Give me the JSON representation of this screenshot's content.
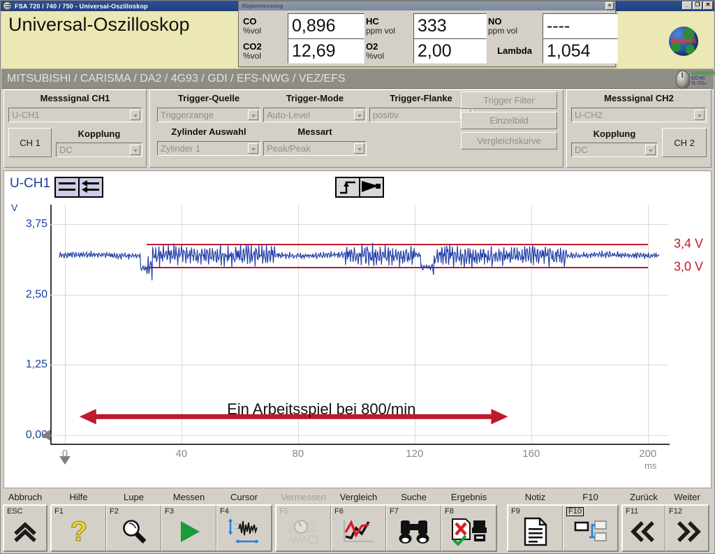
{
  "window": {
    "title": "FSA 720 / 740 / 750 - Universal-Oszilloskop",
    "icon": "oscilloscope-icon",
    "buttons": {
      "minimize": "_",
      "restore": "❐",
      "close": "✕"
    }
  },
  "header": {
    "title": "Universal-Oszilloskop",
    "logo_text": "BOSCH"
  },
  "abgas": {
    "title": "Abgasmessung",
    "close_label": "✕",
    "measurements": [
      {
        "name": "CO",
        "unit": "%vol",
        "value": "0,896"
      },
      {
        "name": "HC",
        "unit": "ppm vol",
        "value": "333"
      },
      {
        "name": "NO",
        "unit": "ppm vol",
        "value": "----"
      },
      {
        "name": "CO2",
        "unit": "%vol",
        "value": "12,69"
      },
      {
        "name": "O2",
        "unit": "%vol",
        "value": "2,00"
      },
      {
        "name": "Lambda",
        "unit": "",
        "value": "1,054"
      }
    ]
  },
  "breadcrumb": {
    "text": "MITSUBISHI / CARISMA / DA2 / 4G93 / GDI / EFS-NWG / VEZ/EFS"
  },
  "controls": {
    "ch1": {
      "group_title": "Messsignal CH1",
      "signal": "U-CH1",
      "channel_button": "CH 1",
      "coupling_title": "Kopplung",
      "coupling": "DC"
    },
    "trigger": {
      "source_title": "Trigger-Quelle",
      "source": "Triggerzange",
      "mode_title": "Trigger-Mode",
      "mode": "Auto-Level",
      "edge_title": "Trigger-Flanke",
      "edge": "positiv",
      "cylinder_title": "Zylinder Auswahl",
      "cylinder": "Zylinder 1",
      "measure_title": "Messart",
      "measure": "Peak/Peak",
      "filter_button": "Trigger Filter",
      "single_button": "Einzelbild",
      "compare_button": "Vergleichskurve"
    },
    "ch2": {
      "group_title": "Messsignal CH2",
      "signal": "U-CH2",
      "channel_button": "CH 2",
      "coupling_title": "Kopplung",
      "coupling": "DC"
    }
  },
  "chart_data": {
    "type": "line",
    "title": "U-CH1",
    "xlabel": "ms",
    "ylabel": "V",
    "xlim": [
      -5,
      207
    ],
    "ylim": [
      -0.15,
      4.1
    ],
    "xticks": [
      0,
      40,
      80,
      120,
      160,
      200
    ],
    "xticklabels": [
      "0",
      "40",
      "80",
      "120",
      "160",
      "200"
    ],
    "yticks": [
      0.0,
      1.25,
      2.5,
      3.75
    ],
    "yticklabels": [
      "0,00",
      "1,25",
      "2,50",
      "3,75"
    ],
    "grid": true,
    "series": [
      {
        "name": "U-CH1",
        "color": "#2340a8",
        "description": "Noisy injector/sensor voltage signal oscillating around 3,2 V with higher-amplitude bursts",
        "baseline": 3.2,
        "noise_amplitude": 0.06,
        "burst_amplitude": 0.2
      }
    ],
    "limit_lines": [
      {
        "label": "3,4 V",
        "value": 3.4,
        "color": "#c0182c",
        "x_start": 28,
        "x_end": 200
      },
      {
        "label": "3,0 V",
        "value": 3.0,
        "color": "#c0182c",
        "x_start": 28,
        "x_end": 200
      }
    ],
    "annotations": [
      {
        "text": "Ein Arbeitsspiel bei 800/min",
        "x_center": 88,
        "y_text": 0.62,
        "arrow_y": 0.33,
        "arrow_x_start": 5,
        "arrow_x_end": 152,
        "color": "#c0182c"
      }
    ],
    "cursors": [
      {
        "axis": "y",
        "value": 0.0,
        "icon": "left-triangle-cursor"
      },
      {
        "axis": "x",
        "value": 0.0,
        "icon": "down-triangle-cursor"
      }
    ],
    "toolbar_icons": [
      {
        "name": "channel-position-icon",
        "x": 6
      },
      {
        "name": "trigger-edge-icon",
        "x": 100
      }
    ]
  },
  "functionbar": {
    "groups": [
      {
        "keys": [
          {
            "caption": "Abbruch",
            "fkey": "ESC",
            "icon": "double-chevron-up-icon",
            "disabled": false,
            "boxed": false
          }
        ]
      },
      {
        "keys": [
          {
            "caption": "Hilfe",
            "fkey": "F1",
            "icon": "question-mark-icon",
            "disabled": false,
            "boxed": false
          },
          {
            "caption": "Lupe",
            "fkey": "F2",
            "icon": "magnifier-icon",
            "disabled": false,
            "boxed": false
          },
          {
            "caption": "Messen",
            "fkey": "F3",
            "icon": "play-triangle-icon",
            "disabled": false,
            "boxed": false
          },
          {
            "caption": "Cursor",
            "fkey": "F4",
            "icon": "cursor-waveform-icon",
            "disabled": false,
            "boxed": false
          }
        ]
      },
      {
        "keys": [
          {
            "caption": "Vermessen",
            "fkey": "F5",
            "icon": "gauge-waveform-icon",
            "disabled": true,
            "boxed": false
          },
          {
            "caption": "Vergleich",
            "fkey": "F6",
            "icon": "compare-curves-icon",
            "disabled": false,
            "boxed": false
          },
          {
            "caption": "Suche",
            "fkey": "F7",
            "icon": "binoculars-icon",
            "disabled": false,
            "boxed": false
          },
          {
            "caption": "Ergebnis",
            "fkey": "F8",
            "icon": "result-printer-icon",
            "disabled": false,
            "boxed": false
          }
        ]
      },
      {
        "keys": [
          {
            "caption": "Notiz",
            "fkey": "F9",
            "icon": "document-icon",
            "disabled": false,
            "boxed": false
          },
          {
            "caption": "F10",
            "fkey": "F10",
            "icon": "window-tile-icon",
            "disabled": false,
            "boxed": true
          }
        ]
      },
      {
        "keys": [
          {
            "caption": "Zurück",
            "fkey": "F11",
            "icon": "double-chevron-left-icon",
            "disabled": false,
            "boxed": false
          },
          {
            "caption": "Weiter",
            "fkey": "F12",
            "icon": "double-chevron-right-icon",
            "disabled": false,
            "boxed": false
          }
        ]
      }
    ]
  }
}
